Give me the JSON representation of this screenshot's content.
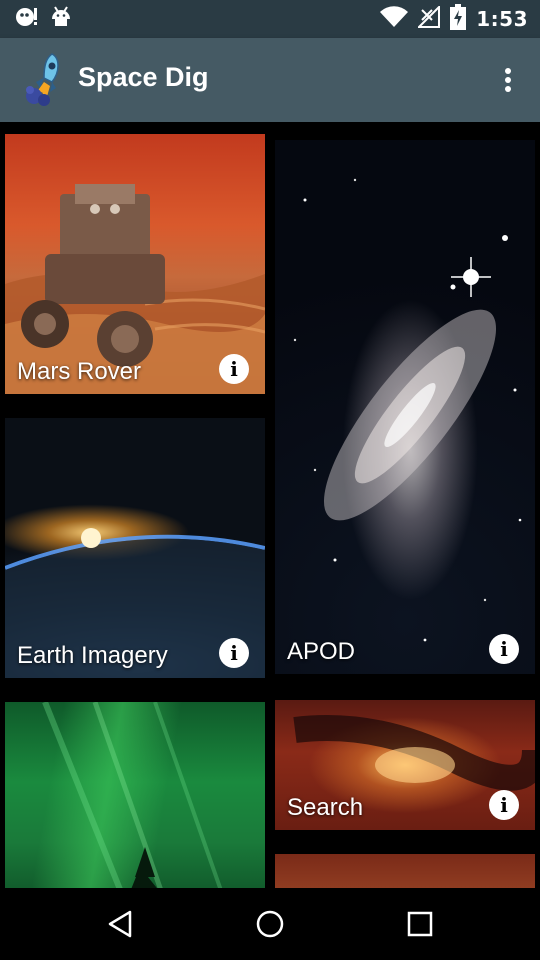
{
  "status_bar": {
    "time": "1:53",
    "left_icons": [
      "notification-icon",
      "android-icon"
    ],
    "right_icons": [
      "wifi-icon",
      "no-signal-icon",
      "battery-charging-icon"
    ]
  },
  "app_bar": {
    "title": "Space Dig",
    "logo_icon": "rocket-logo-icon",
    "menu_icon": "overflow-menu-icon"
  },
  "cards": [
    {
      "label": "Mars Rover",
      "info_icon": "info-icon"
    },
    {
      "label": "APOD",
      "info_icon": "info-icon"
    },
    {
      "label": "Earth Imagery",
      "info_icon": "info-icon"
    },
    {
      "label": "",
      "info_icon": ""
    },
    {
      "label": "Search",
      "info_icon": "info-icon"
    },
    {
      "label": "",
      "info_icon": ""
    }
  ],
  "nav_bar": {
    "icons": [
      "back-icon",
      "home-icon",
      "recents-icon"
    ]
  },
  "colors": {
    "status_bar": "#2a3b44",
    "app_bar": "#455a64",
    "background": "#000000"
  }
}
